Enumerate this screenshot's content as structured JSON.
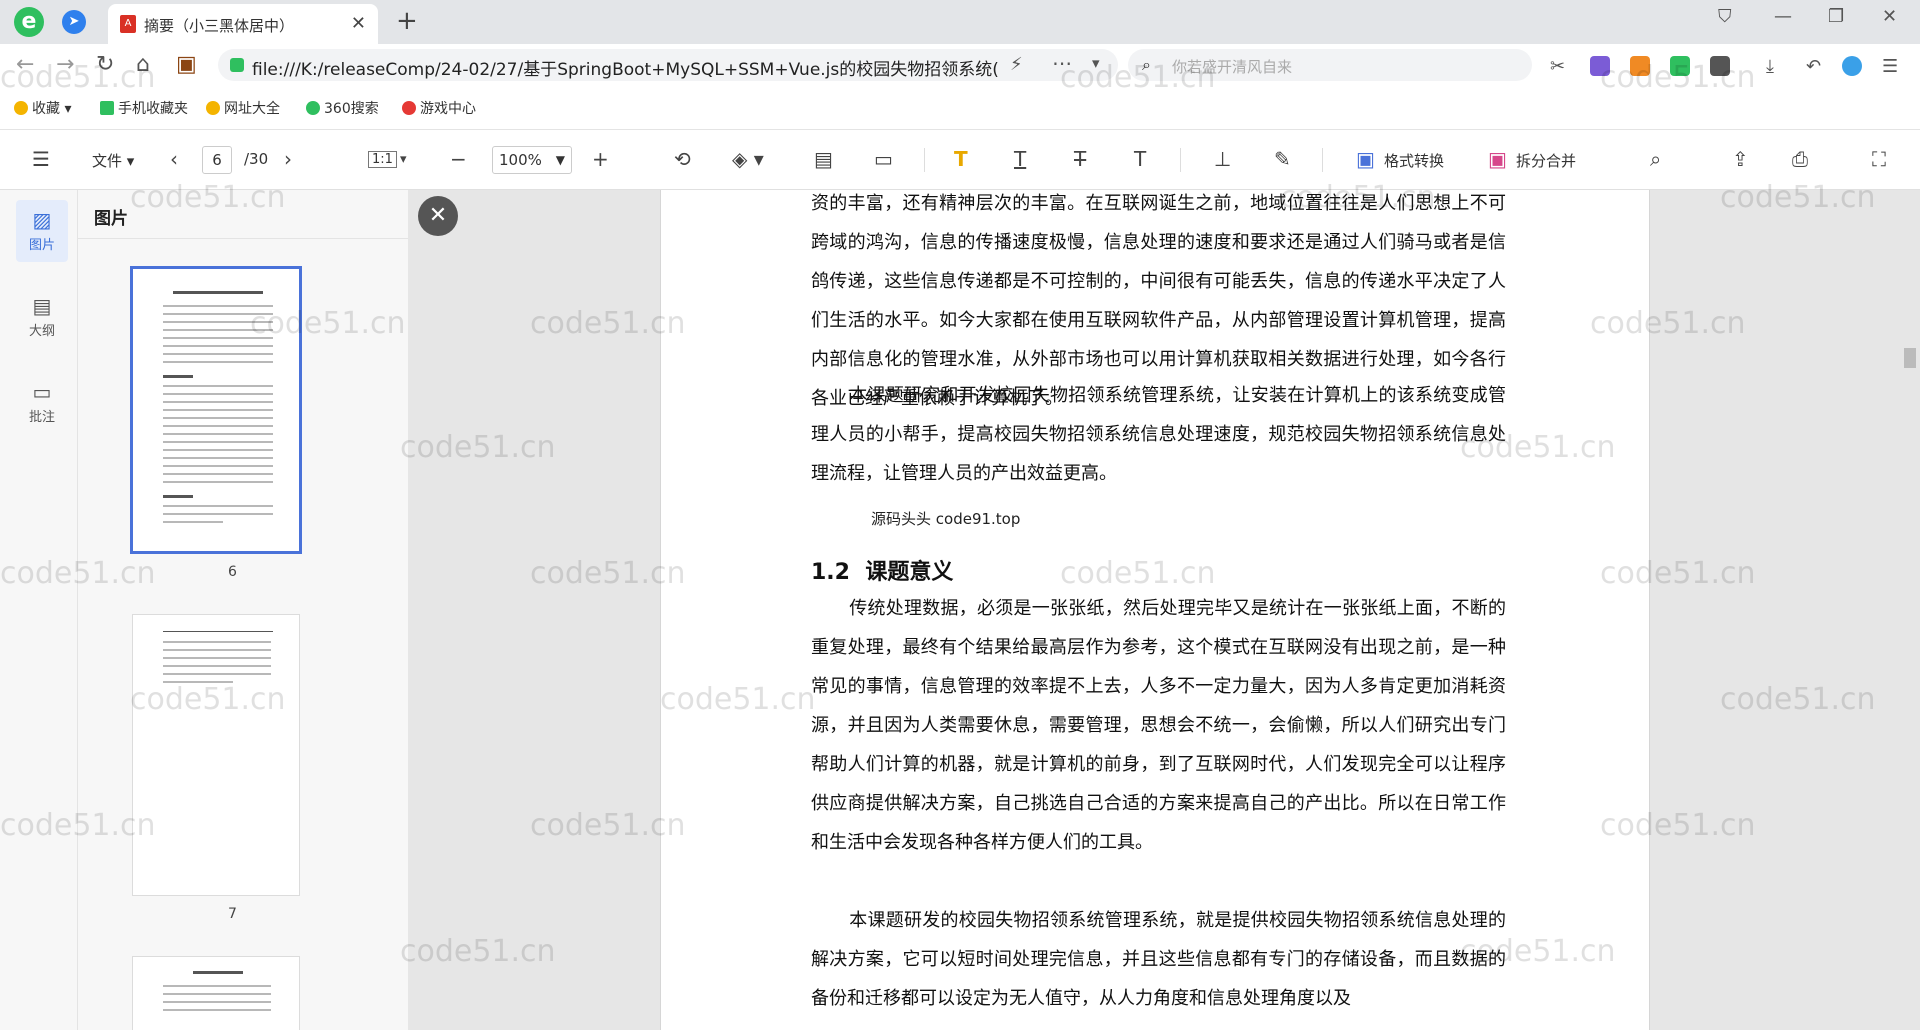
{
  "browser": {
    "tab_title": "摘要（小三黑体居中）",
    "url": "file:///K:/releaseComp/24-02/27/基于SpringBoot+MySQL+SSM+Vue.js的校园失物招领系统(",
    "search_placeholder": "你若盛开清风自来"
  },
  "bookmarks": [
    {
      "label": "收藏",
      "color": "#f4b400"
    },
    {
      "label": "手机收藏夹",
      "color": "#2fbf5f"
    },
    {
      "label": "网址大全",
      "color": "#f4b400"
    },
    {
      "label": "360搜索",
      "color": "#2fbf5f"
    },
    {
      "label": "游戏中心",
      "color": "#e53935"
    }
  ],
  "toolbar": {
    "file_label": "文件",
    "page_current": "6",
    "page_total": "/30",
    "fit_label": "1:1",
    "zoom": "100%",
    "convert_label": "格式转换",
    "split_merge_label": "拆分合并"
  },
  "rail": {
    "images_label": "图片",
    "outline_label": "大纲",
    "annotations_label": "批注"
  },
  "thumbnails": {
    "header": "图片",
    "pages": [
      "6",
      "7"
    ]
  },
  "document": {
    "para1": "资的丰富，还有精神层次的丰富。在互联网诞生之前，地域位置往往是人们思想上不可跨域的鸿沟，信息的传播速度极慢，信息处理的速度和要求还是通过人们骑马或者是信鸽传递，这些信息传递都是不可控制的，中间很有可能丢失，信息的传递水平决定了人们生活的水平。如今大家都在使用互联网软件产品，从内部管理设置计算机管理，提高内部信息化的管理水准，从外部市场也可以用计算机获取相关数据进行处理，如今各行各业已经严重依赖于计算机了。",
    "para2": "本课题研究和开发校园失物招领系统管理系统，让安装在计算机上的该系统变成管理人员的小帮手，提高校园失物招领系统信息处理速度，规范校园失物招领系统信息处理流程，让管理人员的产出效益更高。",
    "overlay_note": "源码头头 code91.top",
    "section_number": "1.2",
    "section_title": "课题意义",
    "para3": "传统处理数据，必须是一张张纸，然后处理完毕又是统计在一张张纸上面，不断的重复处理，最终有个结果给最高层作为参考，这个模式在互联网没有出现之前，是一种常见的事情，信息管理的效率提不上去，人多不一定力量大，因为人多肯定更加消耗资源，并且因为人类需要休息，需要管理，思想会不统一，会偷懒，所以人们研究出专门帮助人们计算的机器，就是计算机的前身，到了互联网时代，人们发现完全可以让程序供应商提供解决方案，自己挑选自己合适的方案来提高自己的产出比。所以在日常工作和生活中会发现各种各样方便人们的工具。",
    "para4": "本课题研发的校园失物招领系统管理系统，就是提供校园失物招领系统信息处理的解决方案，它可以短时间处理完信息，并且这些信息都有专门的存储设备，而且数据的备份和迁移都可以设定为无人值守，从人力角度和信息处理角度以及"
  },
  "watermark": "code51.cn"
}
